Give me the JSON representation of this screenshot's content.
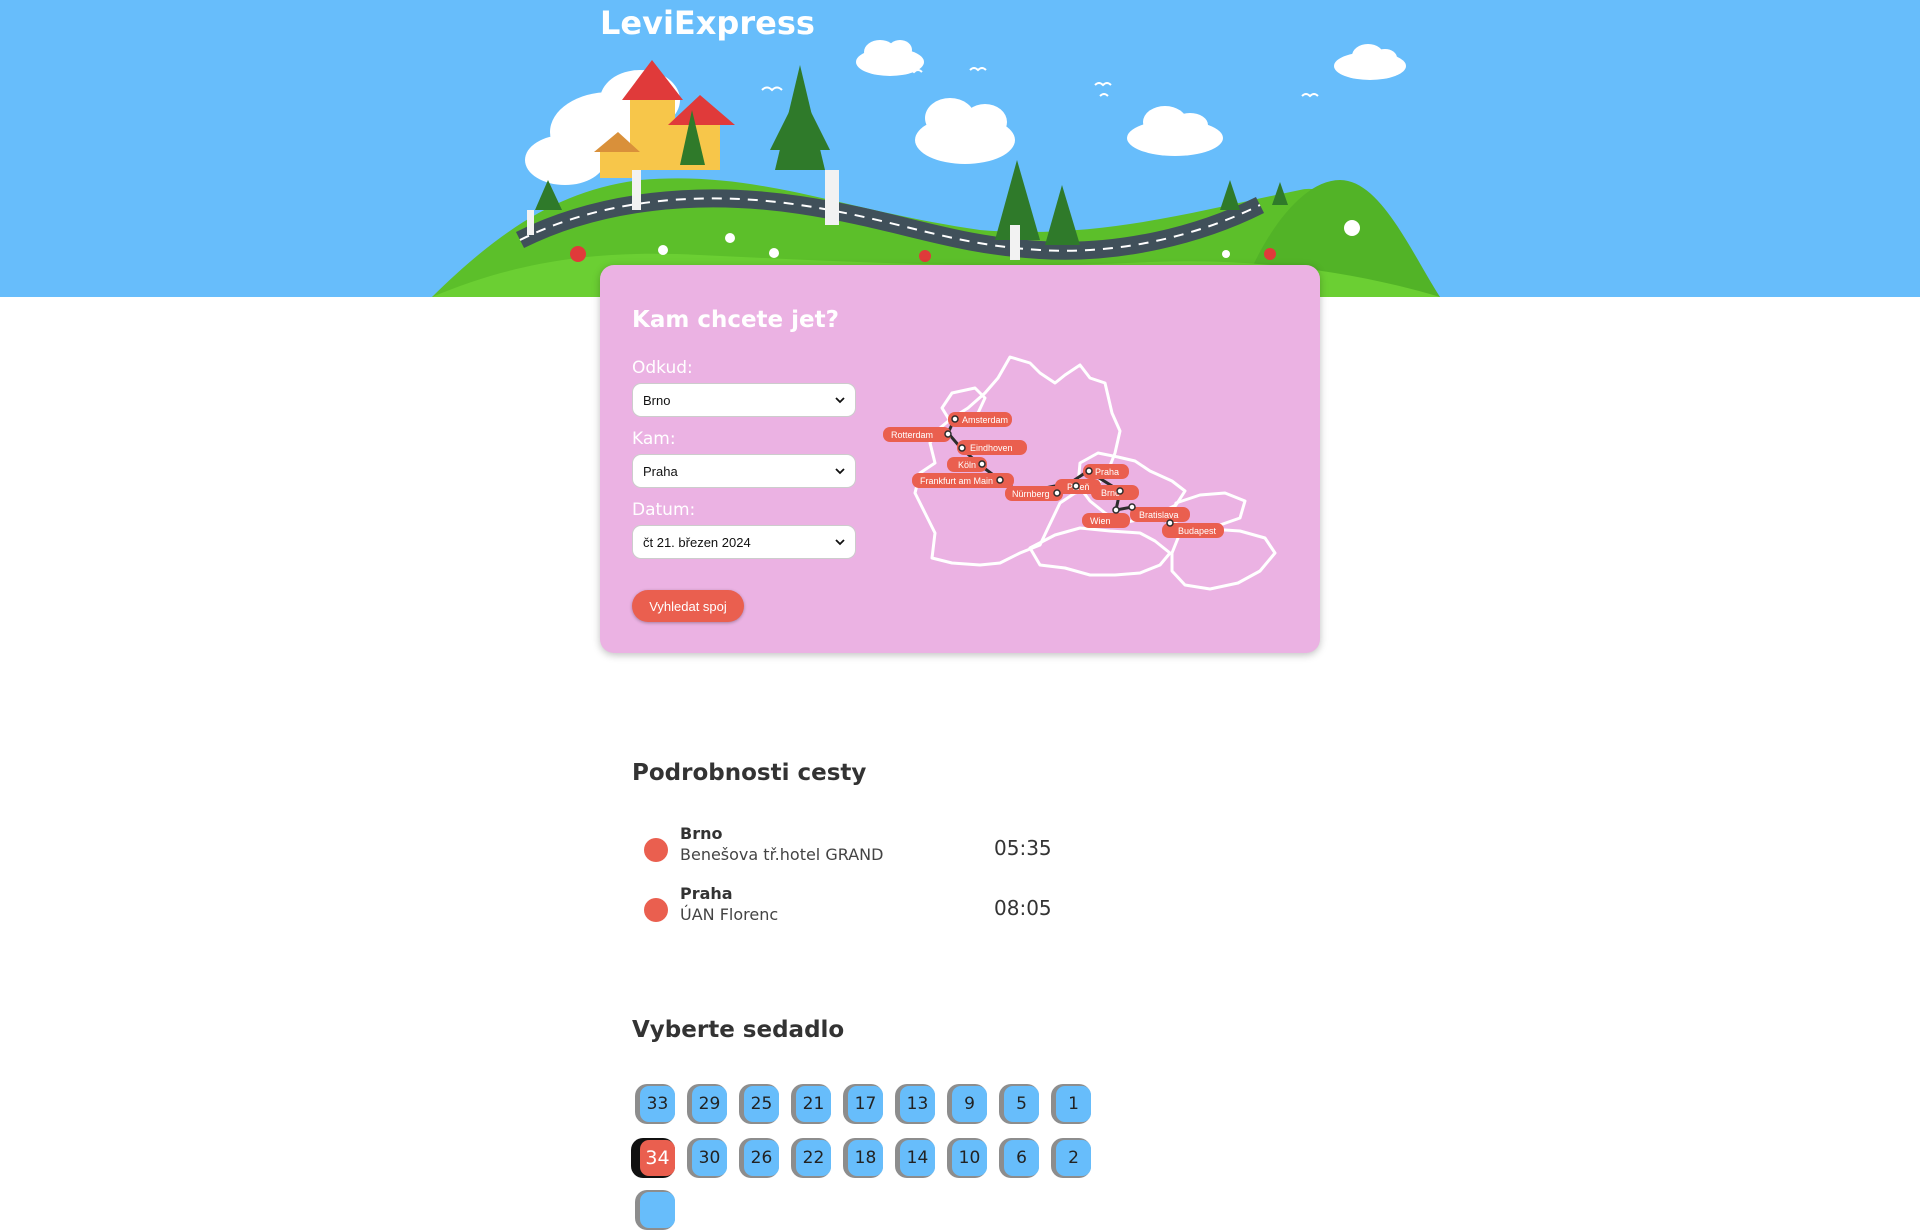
{
  "header": {
    "logo": "LeviExpress"
  },
  "search": {
    "title": "Kam chcete jet?",
    "from_label": "Odkud:",
    "from_value": "Brno",
    "to_label": "Kam:",
    "to_value": "Praha",
    "date_label": "Datum:",
    "date_value": "čt 21. březen 2024",
    "button_label": "Vyhledat spoj"
  },
  "map": {
    "cities": [
      "Amsterdam",
      "Rotterdam",
      "Eindhoven",
      "Köln",
      "Frankfurt am Main",
      "Nürnberg",
      "Plzeň",
      "Praha",
      "Brno",
      "Wien",
      "Bratislava",
      "Budapest"
    ]
  },
  "trip": {
    "title": "Podrobnosti cesty",
    "stops": [
      {
        "city": "Brno",
        "place": "Benešova tř.hotel GRAND",
        "time": "05:35"
      },
      {
        "city": "Praha",
        "place": "ÚAN Florenc",
        "time": "08:05"
      }
    ]
  },
  "seats": {
    "title": "Vyberte sedadlo",
    "row1": [
      "33",
      "29",
      "25",
      "21",
      "17",
      "13",
      "9",
      "5",
      "1"
    ],
    "row2": [
      "34",
      "30",
      "26",
      "22",
      "18",
      "14",
      "10",
      "6",
      "2"
    ],
    "selected": "34"
  },
  "colors": {
    "sky": "#67bdfb",
    "card": "#ebb2e3",
    "accent": "#ea5f4f",
    "seat": "#67bdfb"
  }
}
